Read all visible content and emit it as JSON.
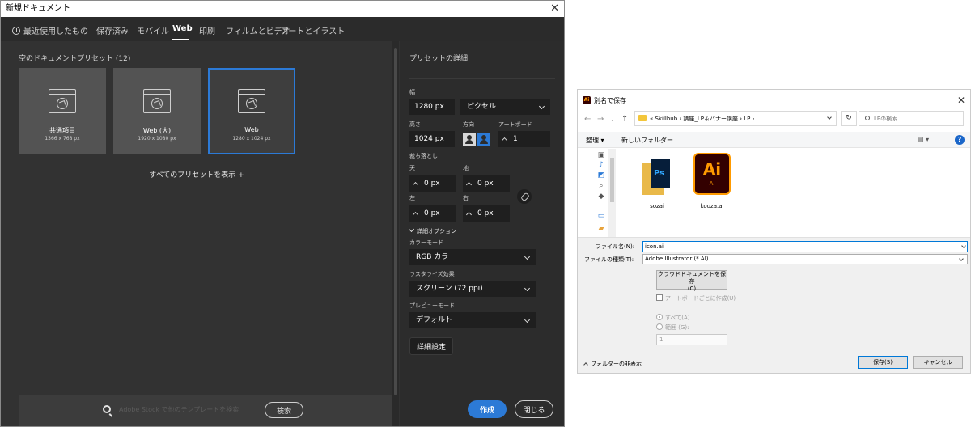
{
  "new_document": {
    "title": "新規ドキュメント",
    "tabs": [
      {
        "label": "最近使用したもの",
        "icon": "clock-icon"
      },
      {
        "label": "保存済み"
      },
      {
        "label": "モバイル"
      },
      {
        "label": "Web",
        "active": true
      },
      {
        "label": "印刷"
      },
      {
        "label": "フィルムとビデオ"
      },
      {
        "label": "アートとイラスト"
      }
    ],
    "presets_header": "空のドキュメントプリセット (12)",
    "presets": [
      {
        "name": "共通項目",
        "size": "1366 x 768 px"
      },
      {
        "name": "Web (大)",
        "size": "1920 x 1080 px"
      },
      {
        "name": "Web",
        "size": "1280 x 1024 px",
        "selected": true
      }
    ],
    "show_all": "すべてのプリセットを表示 +",
    "search": {
      "placeholder": "Adobe Stock で他のテンプレートを検索",
      "button": "検索"
    },
    "details": {
      "title": "プリセットの詳細",
      "width_label": "幅",
      "width_value": "1280 px",
      "unit": "ピクセル",
      "height_label": "高さ",
      "height_value": "1024 px",
      "orientation_label": "方向",
      "artboard_label": "アートボード",
      "artboard_value": "1",
      "bleed_label": "裁ち落とし",
      "top_label": "天",
      "top_value": "0 px",
      "bottom_label": "地",
      "bottom_value": "0 px",
      "left_label": "左",
      "left_value": "0 px",
      "right_label": "右",
      "right_value": "0 px",
      "advanced_label": "詳細オプション",
      "color_mode_label": "カラーモード",
      "color_mode_value": "RGB カラー",
      "raster_label": "ラスタライズ効果",
      "raster_value": "スクリーン (72 ppi)",
      "preview_label": "プレビューモード",
      "preview_value": "デフォルト",
      "detail_settings": "詳細設定",
      "create": "作成",
      "close": "閉じる"
    },
    "colors": {
      "accent": "#2c7ad6",
      "panel": "#323232",
      "field": "#1f1f1f"
    }
  },
  "save_as": {
    "title": "別名で保存",
    "app_icon": "Ai",
    "breadcrumb": "« Skillhub › 講座_LP＆バナー講座 › LP ›",
    "search_placeholder": "LPの検索",
    "toolbar": {
      "organize": "整理 ▾",
      "new_folder": "新しいフォルダー",
      "help": "?"
    },
    "files": [
      {
        "name": "sozai",
        "type": "folder",
        "badge": "Ps"
      },
      {
        "name": "kouza.ai",
        "type": "ai",
        "big": "Ai",
        "small": "AI"
      }
    ],
    "filename_label": "ファイル名(N):",
    "filename_value": "icon.ai",
    "filetype_label": "ファイルの種類(T):",
    "filetype_value": "Adobe Illustrator (*.AI)",
    "cloud_button": "クラウドドキュメントを保存\n(C)",
    "per_artboard": "アートボードごとに作成(U)",
    "all_label": "すべて(A)",
    "range_label": "範囲 (G):",
    "range_value": "1",
    "hide_folders": "フォルダーの非表示",
    "save": "保存(S)",
    "cancel": "キャンセル",
    "colors": {
      "accent": "#0078d7",
      "ai_dark": "#330000",
      "ai_orange": "#ff9a00"
    }
  }
}
